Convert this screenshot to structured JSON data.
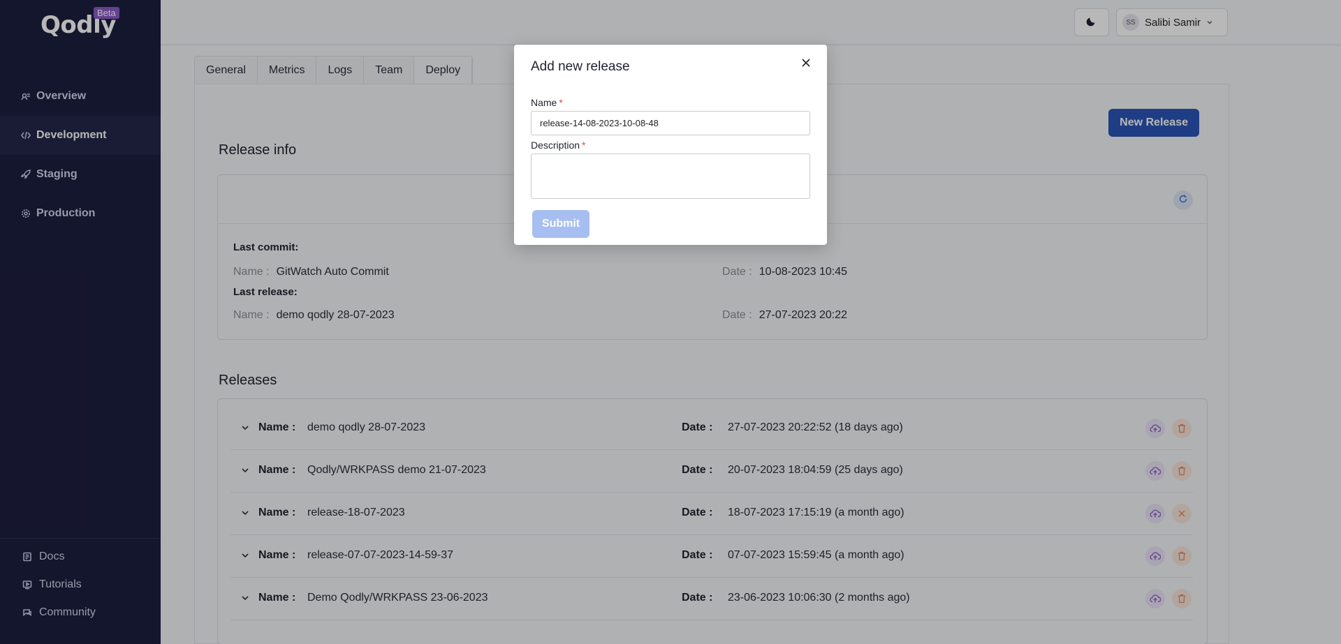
{
  "app": {
    "logo_text": "Qodly",
    "logo_badge": "Beta"
  },
  "sidebar": {
    "items": [
      {
        "label": "Overview",
        "icon": "overview-icon"
      },
      {
        "label": "Development",
        "icon": "code-icon",
        "active": true
      },
      {
        "label": "Staging",
        "icon": "rocket-icon"
      },
      {
        "label": "Production",
        "icon": "gear-icon"
      }
    ],
    "bottom_items": [
      {
        "label": "Docs",
        "icon": "docs-icon"
      },
      {
        "label": "Tutorials",
        "icon": "tutorials-icon"
      },
      {
        "label": "Community",
        "icon": "community-icon"
      }
    ]
  },
  "header": {
    "theme_icon": "moon-icon",
    "user_initials": "SS",
    "user_name": "Salibi Samir"
  },
  "tabs": [
    {
      "label": "General"
    },
    {
      "label": "Metrics"
    },
    {
      "label": "Logs"
    },
    {
      "label": "Team"
    },
    {
      "label": "Deploy",
      "active": true
    }
  ],
  "toolbar": {
    "new_release_label": "New Release"
  },
  "release_info": {
    "title": "Release info",
    "last_commit_label": "Last commit:",
    "last_commit_name_key": "Name :",
    "last_commit_name": "GitWatch Auto Commit",
    "last_commit_date_key": "Date :",
    "last_commit_date": "10-08-2023 10:45",
    "last_release_label": "Last release:",
    "last_release_name_key": "Name :",
    "last_release_name": "demo qodly 28-07-2023",
    "last_release_date_key": "Date :",
    "last_release_date": "27-07-2023 20:22"
  },
  "releases": {
    "title": "Releases",
    "name_key": "Name :",
    "date_key": "Date :",
    "rows": [
      {
        "name": "demo qodly 28-07-2023",
        "date": "27-07-2023 20:22:52 (18 days ago)",
        "action": "delete"
      },
      {
        "name": "Qodly/WRKPASS demo 21-07-2023",
        "date": "20-07-2023 18:04:59 (25 days ago)",
        "action": "delete"
      },
      {
        "name": "release-18-07-2023",
        "date": "18-07-2023 17:15:19 (a month ago)",
        "action": "close"
      },
      {
        "name": "release-07-07-2023-14-59-37",
        "date": "07-07-2023 15:59:45 (a month ago)",
        "action": "delete"
      },
      {
        "name": "Demo Qodly/WRKPASS 23-06-2023",
        "date": "23-06-2023 10:06:30 (2 months ago)",
        "action": "delete"
      }
    ]
  },
  "modal": {
    "title": "Add new release",
    "name_label": "Name",
    "name_value": "release-14-08-2023-10-08-48",
    "description_label": "Description",
    "description_value": "",
    "required_mark": "*",
    "submit_label": "Submit"
  },
  "colors": {
    "sidebar_bg": "#1d1f3f",
    "primary": "#2c55b8",
    "submit_disabled": "#a7bef0",
    "badge": "#8b5cc7"
  }
}
